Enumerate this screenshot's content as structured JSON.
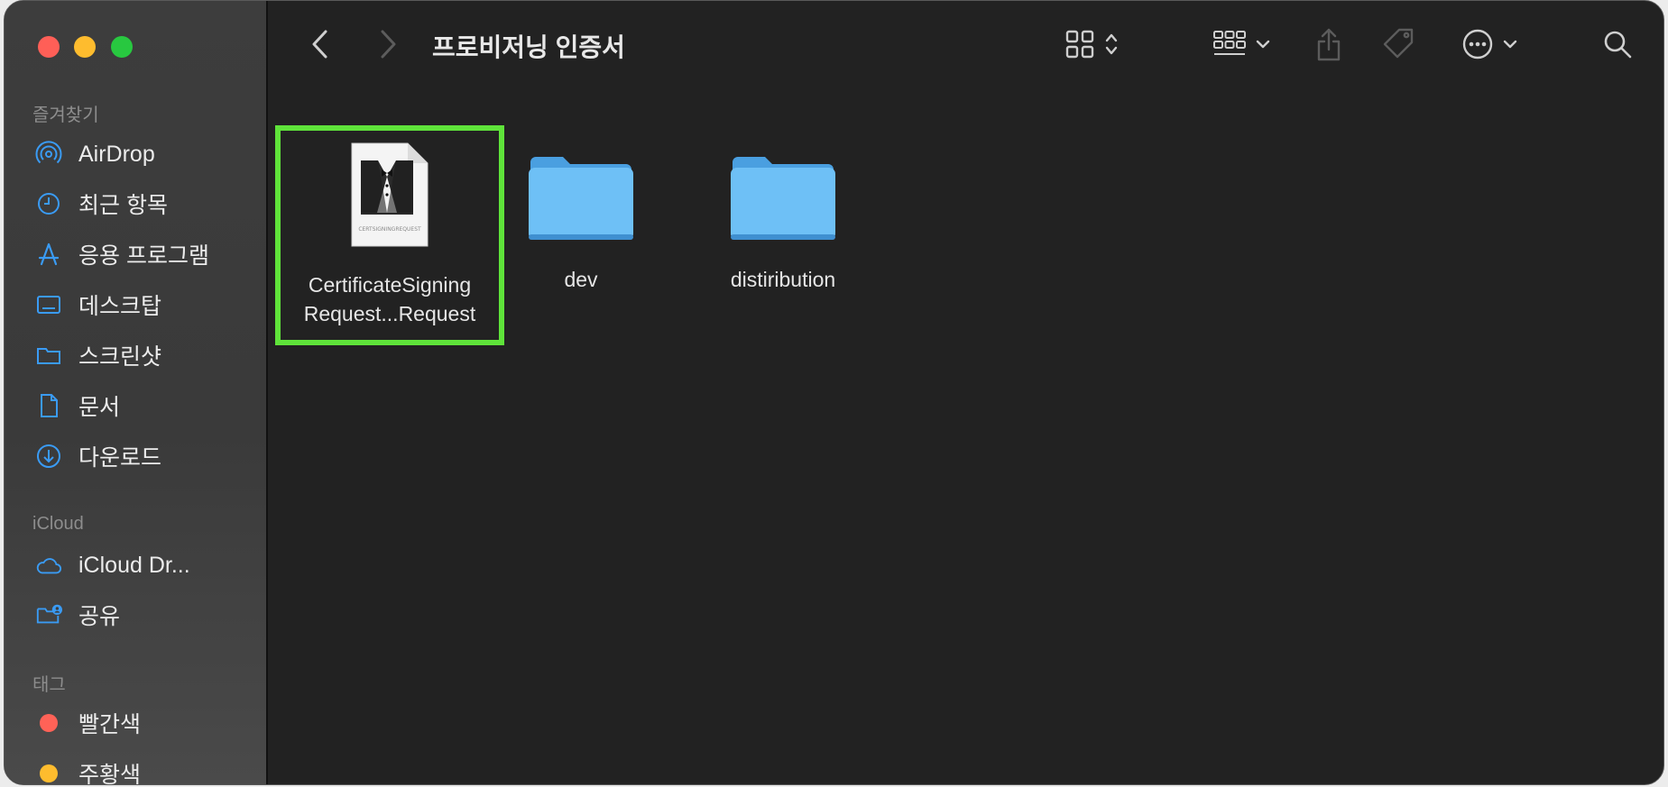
{
  "window": {
    "title": "프로비저닝 인증서"
  },
  "sidebar": {
    "favorites_title": "즐겨찾기",
    "favorites": [
      {
        "label": "AirDrop",
        "icon": "airdrop-icon"
      },
      {
        "label": "최근 항목",
        "icon": "clock-icon"
      },
      {
        "label": "응용 프로그램",
        "icon": "applications-icon"
      },
      {
        "label": "데스크탑",
        "icon": "desktop-icon"
      },
      {
        "label": "스크린샷",
        "icon": "folder-icon"
      },
      {
        "label": "문서",
        "icon": "document-icon"
      },
      {
        "label": "다운로드",
        "icon": "download-icon"
      }
    ],
    "icloud_title": "iCloud",
    "icloud": [
      {
        "label": "iCloud Dr...",
        "icon": "cloud-icon"
      },
      {
        "label": "공유",
        "icon": "shared-folder-icon"
      }
    ],
    "tags_title": "태그",
    "tags": [
      {
        "label": "빨간색",
        "color": "#ff6257"
      },
      {
        "label": "주황색",
        "color": "#febc2e"
      }
    ]
  },
  "files": [
    {
      "name_line1": "CertificateSigning",
      "name_line2": "Request...Request",
      "kind": "certsigningrequest-file-icon",
      "selected": true,
      "file_label": "CERTSIGNINGREQUEST"
    },
    {
      "name_line1": "dev",
      "kind": "folder-icon"
    },
    {
      "name_line1": "distiribution",
      "kind": "folder-icon"
    }
  ],
  "colors": {
    "accent": "#3a9bf4",
    "selection": "#5fe33a",
    "folder": "#6ec0f6"
  }
}
